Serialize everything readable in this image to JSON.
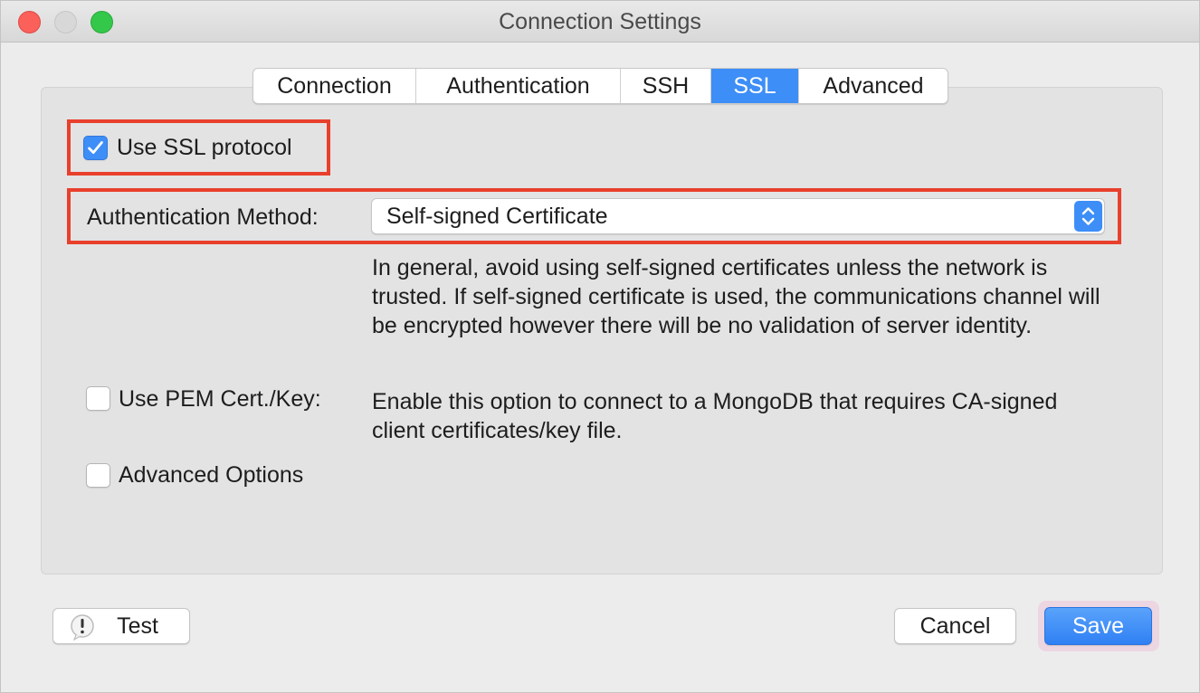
{
  "window": {
    "title": "Connection Settings"
  },
  "tabs": [
    {
      "label": "Connection",
      "active": false
    },
    {
      "label": "Authentication",
      "active": false
    },
    {
      "label": "SSH",
      "active": false
    },
    {
      "label": "SSL",
      "active": true
    },
    {
      "label": "Advanced",
      "active": false
    }
  ],
  "ssl": {
    "use_ssl_label": "Use SSL protocol",
    "use_ssl_checked": true,
    "auth_method_label": "Authentication Method:",
    "auth_method_value": "Self-signed Certificate",
    "auth_method_help": "In general, avoid using self-signed certificates unless the network is trusted. If self-signed certificate is used, the communications channel will be encrypted however there will be no validation of server identity.",
    "pem_label": "Use PEM Cert./Key:",
    "pem_checked": false,
    "pem_help": "Enable this option to connect to a MongoDB that requires CA-signed client certificates/key file.",
    "advanced_options_label": "Advanced Options",
    "advanced_options_checked": false
  },
  "buttons": {
    "test_label": "Test",
    "cancel_label": "Cancel",
    "save_label": "Save"
  },
  "colors": {
    "accent": "#3d8ef7",
    "highlight": "#e8402c"
  }
}
